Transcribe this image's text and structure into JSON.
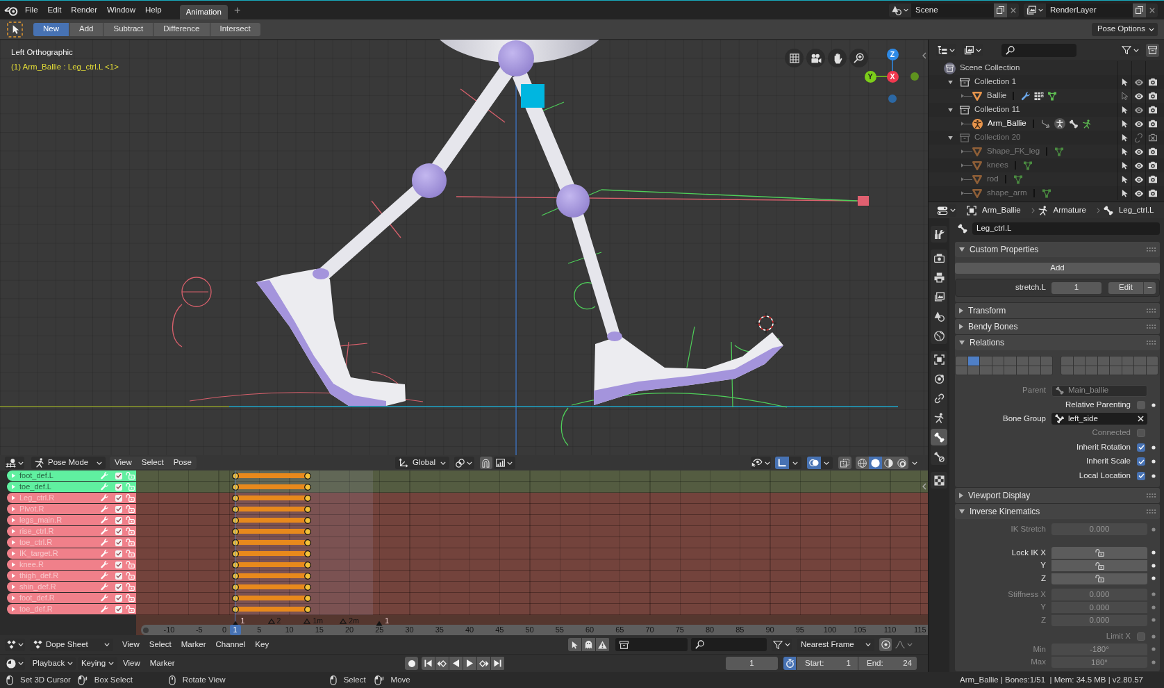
{
  "topbar": {
    "menus": [
      "File",
      "Edit",
      "Render",
      "Window",
      "Help"
    ],
    "workspaces": [
      {
        "label": "Animation",
        "selected": true
      }
    ],
    "add_workspace": "+",
    "scene": "Scene",
    "view_layer": "RenderLayer"
  },
  "tool_header": {
    "modes": [
      {
        "label": "New",
        "selected": true
      },
      {
        "label": "Add",
        "selected": false
      },
      {
        "label": "Subtract",
        "selected": false
      },
      {
        "label": "Difference",
        "selected": false
      },
      {
        "label": "Intersect",
        "selected": false
      }
    ],
    "pose_options": "Pose Options"
  },
  "viewport": {
    "view_name": "Left Orthographic",
    "object_info": "(1) Arm_Ballie : Leg_ctrl.L <1>",
    "axes": [
      {
        "label": "Z",
        "color": "#2e8ae6"
      },
      {
        "label": "Y",
        "color": "#7ccd1a"
      },
      {
        "label": "X",
        "color": "#f0384f"
      }
    ],
    "header": {
      "mode": "Pose Mode",
      "menus": [
        "View",
        "Select",
        "Pose"
      ],
      "orientation": "Global",
      "snap": false,
      "gizmos": true,
      "overlays": true,
      "xray": false,
      "shading": [
        {
          "kind": "wireframe",
          "selected": false
        },
        {
          "kind": "solid",
          "selected": true
        },
        {
          "kind": "material",
          "selected": false
        },
        {
          "kind": "rendered",
          "selected": false
        }
      ]
    }
  },
  "dope_sheet": {
    "channels": [
      {
        "name": "foot_def.L",
        "color": "#60f0a0",
        "checked": true
      },
      {
        "name": "toe_def.L",
        "color": "#60f0a0",
        "checked": true
      },
      {
        "name": "Leg_ctrl.R",
        "color": "#f0808a",
        "checked": true
      },
      {
        "name": "Pivot.R",
        "color": "#f0808a",
        "checked": true
      },
      {
        "name": "legs_main.R",
        "color": "#f0808a",
        "checked": true
      },
      {
        "name": "rise_ctrl.R",
        "color": "#f0808a",
        "checked": true
      },
      {
        "name": "toe_ctrl.R",
        "color": "#f0808a",
        "checked": true
      },
      {
        "name": "IK_target.R",
        "color": "#f0808a",
        "checked": true
      },
      {
        "name": "knee.R",
        "color": "#f0808a",
        "checked": true
      },
      {
        "name": "thigh_def.R",
        "color": "#f0808a",
        "checked": true
      },
      {
        "name": "shin_def.R",
        "color": "#f0808a",
        "checked": true
      },
      {
        "name": "foot_def.R",
        "color": "#f0808a",
        "checked": true
      },
      {
        "name": "toe_def.R",
        "color": "#f0808a",
        "checked": true
      }
    ],
    "markers": [
      {
        "label": "1",
        "selected": true
      },
      {
        "label": "2",
        "selected": false
      },
      {
        "label": "1m",
        "selected": false
      },
      {
        "label": "2m",
        "selected": false
      },
      {
        "label": "1",
        "selected": true
      }
    ],
    "ruler": {
      "ticks": [
        "-10",
        "-5",
        "0",
        "5",
        "10",
        "15",
        "20",
        "25",
        "30",
        "35",
        "40",
        "45",
        "50",
        "55",
        "60",
        "65",
        "70",
        "75",
        "80",
        "85",
        "90",
        "95",
        "100",
        "105",
        "110",
        "115"
      ],
      "current_frame": "1"
    },
    "header": {
      "mode": "Dope Sheet",
      "menus": [
        "View",
        "Select",
        "Marker",
        "Channel",
        "Key"
      ],
      "only_selected": false,
      "show_hidden": false,
      "only_errors": false,
      "snap": "Nearest Frame",
      "proportional": false
    }
  },
  "timeline": {
    "menus": [
      {
        "label": "Playback",
        "kind": "dropdown"
      },
      {
        "label": "Keying",
        "kind": "dropdown"
      },
      {
        "label": "View",
        "kind": "menu"
      },
      {
        "label": "Marker",
        "kind": "menu"
      }
    ],
    "recording": false,
    "current_frame": "1",
    "preview_range": true,
    "start_label": "Start:",
    "start": "1",
    "end_label": "End:",
    "end": "24"
  },
  "outliner": {
    "root": {
      "label": "Scene Collection",
      "selected": false,
      "children": [
        {
          "kind": "collection",
          "label": "Collection 1",
          "expanded": true,
          "selected": false,
          "selectable": true,
          "disabled": false,
          "children": [
            {
              "kind": "mesh",
              "label": "Ballie",
              "expanded": false,
              "selected": false,
              "selectable": false,
              "disabled": false,
              "contents": [
                {
                  "kind": "modifier"
                },
                {
                  "kind": "particles"
                },
                {
                  "kind": "mesh_data"
                }
              ]
            }
          ]
        },
        {
          "kind": "collection",
          "label": "Collection 11",
          "expanded": true,
          "selected": false,
          "selectable": true,
          "disabled": false,
          "children": [
            {
              "kind": "armature",
              "label": "Arm_Ballie",
              "expanded": false,
              "selected": true,
              "selectable": true,
              "disabled": false,
              "contents": [
                {
                  "kind": "pose"
                },
                {
                  "kind": "armature_data"
                },
                {
                  "kind": "bones"
                },
                {
                  "kind": "pose_figure"
                }
              ]
            }
          ]
        },
        {
          "kind": "collection",
          "label": "Collection 20",
          "expanded": true,
          "selected": false,
          "selectable": true,
          "disabled": true,
          "children": [
            {
              "kind": "mesh",
              "label": "Shape_FK_leg",
              "expanded": false,
              "selected": false,
              "selectable": true,
              "disabled": true,
              "contents": [
                {
                  "kind": "mesh_data"
                }
              ]
            },
            {
              "kind": "mesh",
              "label": "knees",
              "expanded": false,
              "selected": false,
              "selectable": true,
              "disabled": true,
              "contents": [
                {
                  "kind": "mesh_data"
                }
              ]
            },
            {
              "kind": "mesh",
              "label": "rod",
              "expanded": false,
              "selected": false,
              "selectable": true,
              "disabled": true,
              "contents": [
                {
                  "kind": "mesh_data"
                }
              ]
            },
            {
              "kind": "mesh",
              "label": "shape_arm",
              "expanded": false,
              "selected": false,
              "selectable": true,
              "disabled": true,
              "contents": [
                {
                  "kind": "mesh_data"
                }
              ]
            }
          ]
        }
      ]
    }
  },
  "properties": {
    "breadcrumbs": [
      {
        "kind": "object",
        "label": "Arm_Ballie"
      },
      {
        "kind": "armature",
        "label": "Armature"
      },
      {
        "kind": "bone",
        "label": "Leg_ctrl.L"
      }
    ],
    "tab_groups": [
      [
        {
          "kind": "tool",
          "selected": false
        }
      ],
      [
        {
          "kind": "render",
          "selected": false
        },
        {
          "kind": "output",
          "selected": false
        },
        {
          "kind": "view_layer",
          "selected": false
        },
        {
          "kind": "scene",
          "selected": false
        },
        {
          "kind": "world",
          "selected": false
        }
      ],
      [
        {
          "kind": "object",
          "selected": false
        },
        {
          "kind": "physics",
          "selected": false
        },
        {
          "kind": "object_constraint",
          "selected": false
        },
        {
          "kind": "armature_data",
          "selected": false
        },
        {
          "kind": "bone",
          "selected": true
        },
        {
          "kind": "bone_constraint",
          "selected": false
        }
      ],
      [
        {
          "kind": "texture",
          "selected": false
        }
      ]
    ],
    "bone_name": "Leg_ctrl.L",
    "panels": [
      {
        "kind": "custom_properties",
        "title": "Custom Properties",
        "expanded": true,
        "add_label": "Add",
        "items": [
          {
            "label": "stretch.L",
            "value": "1",
            "edit_label": "Edit",
            "remove_label": "−"
          }
        ]
      },
      {
        "title": "Transform",
        "expanded": false
      },
      {
        "title": "Bendy Bones",
        "expanded": false
      },
      {
        "kind": "relations",
        "title": "Relations",
        "expanded": true,
        "layers": [
          {
            "selected": false
          },
          {
            "selected": true
          },
          {
            "selected": false
          },
          {
            "selected": false
          },
          {
            "selected": false
          },
          {
            "selected": false
          },
          {
            "selected": false
          },
          {
            "selected": false
          },
          {
            "selected": false
          },
          {
            "selected": false
          },
          {
            "selected": false
          },
          {
            "selected": false
          },
          {
            "selected": false
          },
          {
            "selected": false
          },
          {
            "selected": false
          },
          {
            "selected": false
          },
          {
            "selected": false
          },
          {
            "selected": false
          },
          {
            "selected": false
          },
          {
            "selected": false
          },
          {
            "selected": false
          },
          {
            "selected": false
          },
          {
            "selected": false
          },
          {
            "selected": false
          },
          {
            "selected": false
          },
          {
            "selected": false
          },
          {
            "selected": false
          },
          {
            "selected": false
          },
          {
            "selected": false
          },
          {
            "selected": false
          },
          {
            "selected": false
          },
          {
            "selected": false
          }
        ],
        "rows": [
          {
            "kind": "bone_field",
            "label": "Parent",
            "value": "Main_ballie",
            "disabled": true,
            "animatable": false
          },
          {
            "kind": "checkbox",
            "label": "Relative Parenting",
            "checked": false,
            "disabled": false,
            "animatable": true
          },
          {
            "kind": "group_field",
            "label": "Bone Group",
            "value": "left_side",
            "disabled": false,
            "animatable": false
          },
          {
            "kind": "checkbox",
            "label": "Connected",
            "checked": false,
            "disabled": true,
            "animatable": false
          },
          {
            "kind": "checkbox",
            "label": "Inherit Rotation",
            "checked": true,
            "disabled": false,
            "animatable": true
          },
          {
            "kind": "checkbox",
            "label": "Inherit Scale",
            "checked": true,
            "disabled": false,
            "animatable": true
          },
          {
            "kind": "checkbox",
            "label": "Local Location",
            "checked": true,
            "disabled": false,
            "animatable": true
          }
        ]
      },
      {
        "title": "Viewport Display",
        "expanded": false
      },
      {
        "kind": "groups",
        "title": "Inverse Kinematics",
        "expanded": true,
        "groups": [
          [
            {
              "kind": "number",
              "label": "IK Stretch",
              "value": "0.000",
              "disabled": true,
              "animatable": true
            }
          ],
          [
            {
              "kind": "lock",
              "label": "Lock IK X",
              "locked": false,
              "disabled": false,
              "animatable": true
            },
            {
              "kind": "lock",
              "label": "Y",
              "locked": false,
              "disabled": false,
              "animatable": true
            },
            {
              "kind": "lock",
              "label": "Z",
              "locked": false,
              "disabled": false,
              "animatable": true
            }
          ],
          [
            {
              "kind": "number",
              "label": "Stiffness X",
              "value": "0.000",
              "disabled": true,
              "animatable": true
            },
            {
              "kind": "number",
              "label": "Y",
              "value": "0.000",
              "disabled": true,
              "animatable": true
            },
            {
              "kind": "number",
              "label": "Z",
              "value": "0.000",
              "disabled": true,
              "animatable": true
            }
          ],
          [
            {
              "kind": "checkbox",
              "label": "Limit X",
              "checked": false,
              "disabled": true,
              "animatable": true
            },
            {
              "kind": "number",
              "label": "Min",
              "value": "-180°",
              "disabled": true,
              "animatable": true
            },
            {
              "kind": "number",
              "label": "Max",
              "value": "180°",
              "disabled": true,
              "animatable": true
            }
          ]
        ]
      }
    ]
  },
  "status_bar": {
    "hint_groups": [
      [
        {
          "kind": "left",
          "label": "Set 3D Cursor"
        },
        {
          "kind": "drag",
          "label": "Box Select"
        },
        {
          "kind": "middle",
          "label": "Rotate View"
        }
      ],
      [
        {
          "kind": "left",
          "label": "Select"
        },
        {
          "kind": "drag",
          "label": "Move"
        }
      ]
    ],
    "stats": "Arm_Ballie | Bones:1/51  | Mem: 34.5 MB | v2.80.57"
  }
}
